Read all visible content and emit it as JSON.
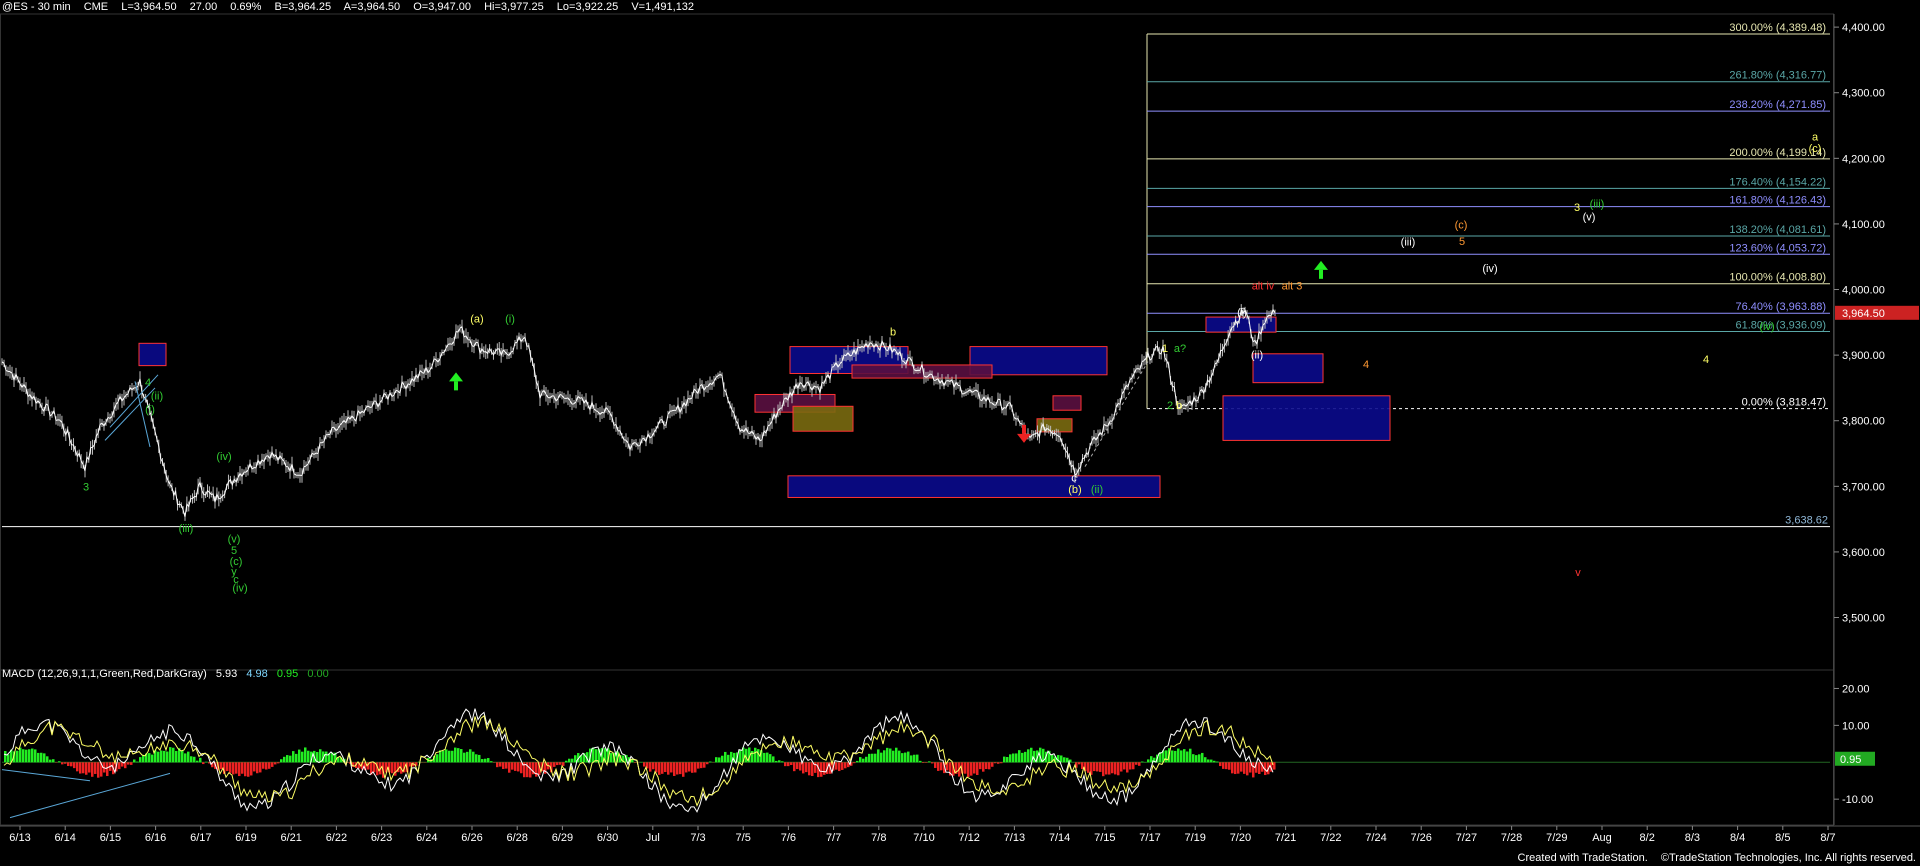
{
  "header": {
    "symbol": "@ES - 30 min",
    "exchange": "CME",
    "last": "L=3,964.50",
    "change": "27.00",
    "change_pct": "0.69%",
    "bid": "B=3,964.25",
    "ask": "A=3,964.50",
    "open": "O=3,947.00",
    "high": "Hi=3,977.25",
    "low": "Lo=3,922.25",
    "volume": "V=1,491,132"
  },
  "price_axis": {
    "ylim": [
      3420,
      4420
    ],
    "ticks": [
      {
        "value": 4400,
        "label": "4,400.00"
      },
      {
        "value": 4300,
        "label": "4,300.00"
      },
      {
        "value": 4200,
        "label": "4,200.00"
      },
      {
        "value": 4100,
        "label": "4,100.00"
      },
      {
        "value": 4000,
        "label": "4,000.00"
      },
      {
        "value": 3900,
        "label": "3,900.00"
      },
      {
        "value": 3800,
        "label": "3,800.00"
      },
      {
        "value": 3700,
        "label": "3,700.00"
      },
      {
        "value": 3600,
        "label": "3,600.00"
      },
      {
        "value": 3500,
        "label": "3,500.00"
      }
    ],
    "last_price_label": "3,964.50",
    "last_price": 3964.5,
    "support_line": 3638.62,
    "support_label": "3,638.62"
  },
  "macd": {
    "title": "MACD (12,26,9,1,1,Green,Red,DarkGray)",
    "macd_value": "5.93",
    "signal_value": "4.98",
    "hist_value": "0.95",
    "zero_value": "0.00",
    "ylim": [
      -17,
      25
    ],
    "ticks": [
      {
        "value": 20,
        "label": "20.00"
      },
      {
        "value": 10,
        "label": "10.00"
      },
      {
        "value": -10,
        "label": "-10.00"
      }
    ],
    "current_label": "0.95",
    "current": 0.95
  },
  "time_axis": {
    "labels": [
      "6/13",
      "6/14",
      "6/15",
      "6/16",
      "6/17",
      "6/19",
      "6/21",
      "6/22",
      "6/23",
      "6/24",
      "6/26",
      "6/28",
      "6/29",
      "6/30",
      "Jul",
      "7/3",
      "7/5",
      "7/6",
      "7/7",
      "7/8",
      "7/10",
      "7/12",
      "7/13",
      "7/14",
      "7/15",
      "7/17",
      "7/19",
      "7/20",
      "7/21",
      "7/22",
      "7/24",
      "7/26",
      "7/27",
      "7/28",
      "7/29",
      "Aug",
      "8/2",
      "8/3",
      "8/4",
      "8/5",
      "8/7"
    ]
  },
  "fib_levels": [
    {
      "label": "300.00% (4,389.48)",
      "price": 4389.48,
      "color": "#e6e6b0"
    },
    {
      "label": "261.80% (4,316.77)",
      "price": 4316.77,
      "color": "#5aa7a7"
    },
    {
      "label": "238.20% (4,271.85)",
      "price": 4271.85,
      "color": "#8f8fff"
    },
    {
      "label": "200.00% (4,199.14)",
      "price": 4199.14,
      "color": "#e6e6b0"
    },
    {
      "label": "176.40% (4,154.22)",
      "price": 4154.22,
      "color": "#5aa7a7"
    },
    {
      "label": "161.80% (4,126.43)",
      "price": 4126.43,
      "color": "#8f8fff"
    },
    {
      "label": "138.20% (4,081.61)",
      "price": 4081.61,
      "color": "#5aa7a7"
    },
    {
      "label": "123.60% (4,053.72)",
      "price": 4053.72,
      "color": "#8f8fff"
    },
    {
      "label": "100.00% (4,008.80)",
      "price": 4008.8,
      "color": "#e6e6b0"
    },
    {
      "label": "76.40% (3,963.88)",
      "price": 3963.88,
      "color": "#8f8fff"
    },
    {
      "label": "61.80% (3,936.09)",
      "price": 3936.09,
      "color": "#5aa7a7"
    },
    {
      "label": "0.00% (3,818.47)",
      "price": 3818.47,
      "color": "#ffffff"
    }
  ],
  "wave_labels": [
    {
      "text": "3",
      "color": "#33cc33"
    },
    {
      "text": "4",
      "color": "#33cc33"
    },
    {
      "text": "(ii)",
      "color": "#33cc33"
    },
    {
      "text": "(i)",
      "color": "#33cc33"
    },
    {
      "text": "(iii)",
      "color": "#33cc33"
    },
    {
      "text": "(iv)",
      "color": "#33cc33"
    },
    {
      "text": "(v)",
      "color": "#33cc33"
    },
    {
      "text": "5",
      "color": "#33cc33"
    },
    {
      "text": "(c)",
      "color": "#33cc33"
    },
    {
      "text": "y",
      "color": "#33cc33"
    },
    {
      "text": "c",
      "color": "#33cc33"
    },
    {
      "text": "(iv)",
      "color": "#33cc33"
    },
    {
      "text": "(a)",
      "color": "#ffff66"
    },
    {
      "text": "(i)",
      "color": "#33cc33"
    },
    {
      "text": "b",
      "color": "#ffff66"
    },
    {
      "text": "c",
      "color": "#ffffff"
    },
    {
      "text": "(b)",
      "color": "#ffff66"
    },
    {
      "text": "(ii)",
      "color": "#33cc33"
    },
    {
      "text": "1",
      "color": "#ffff66"
    },
    {
      "text": "a?",
      "color": "#33cc33"
    },
    {
      "text": "2",
      "color": "#33cc33"
    },
    {
      "text": "b",
      "color": "#ffff66"
    },
    {
      "text": "(i)",
      "color": "#ffffff"
    },
    {
      "text": "(ii)",
      "color": "#ffffff"
    },
    {
      "text": "alt iv",
      "color": "#ff3333"
    },
    {
      "text": "alt 3",
      "color": "#ff9933"
    },
    {
      "text": "(iii)",
      "color": "#ffffff"
    },
    {
      "text": "(c)",
      "color": "#ff9933"
    },
    {
      "text": "5",
      "color": "#ff9933"
    },
    {
      "text": "(iv)",
      "color": "#ffffff"
    },
    {
      "text": "4",
      "color": "#ff9933"
    },
    {
      "text": "3",
      "color": "#ffff66"
    },
    {
      "text": "(iii)",
      "color": "#33cc33"
    },
    {
      "text": "(v)",
      "color": "#ffffff"
    },
    {
      "text": "(iv)",
      "color": "#33cc33"
    },
    {
      "text": "a",
      "color": "#ffff66"
    },
    {
      "text": "(c)",
      "color": "#ffff66"
    },
    {
      "text": "4",
      "color": "#ffff66"
    },
    {
      "text": "v",
      "color": "#ff3333"
    }
  ],
  "credit": {
    "created": "Created with TradeStation.",
    "copyright": "©TradeStation Technologies, Inc. All rights reserved."
  },
  "colors": {
    "background": "#000000",
    "price_line": "#ffffff",
    "fib_box": "#e6e6b0",
    "zone_fill": "#0a0a8c",
    "zone_border": "#ff3333",
    "hist_up": "#22ee22",
    "hist_down": "#ee2222",
    "macd_line": "#ffffff",
    "signal_line": "#ffff66",
    "arrow_up": "#22ee22",
    "arrow_down": "#ee2222"
  }
}
